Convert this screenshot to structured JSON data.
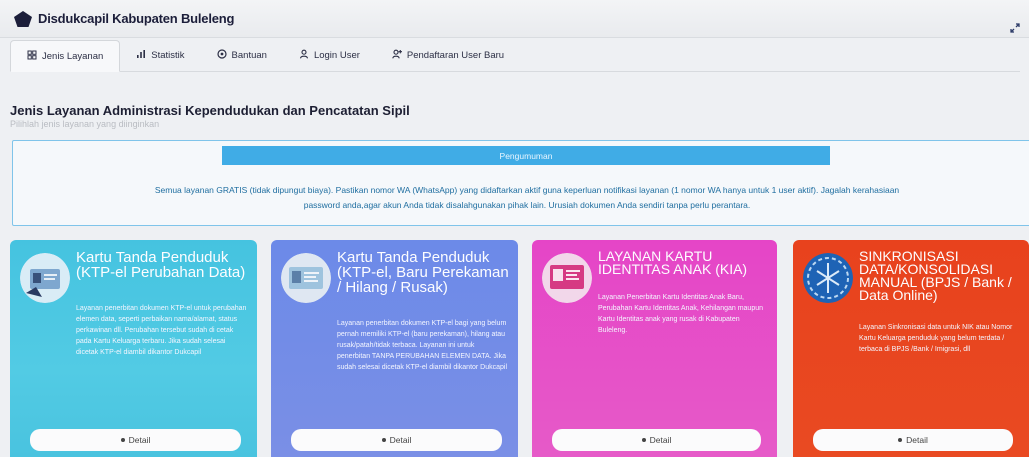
{
  "app": {
    "title": "Disdukcapil Kabupaten Buleleng",
    "logo_icon": "pentagon-logo-icon",
    "expand_icon": "expand-arrows-icon"
  },
  "tabs": [
    {
      "label": "Jenis Layanan",
      "icon": "grid-icon",
      "active": true
    },
    {
      "label": "Statistik",
      "icon": "bar-chart-icon",
      "active": false
    },
    {
      "label": "Bantuan",
      "icon": "help-circle-icon",
      "active": false
    },
    {
      "label": "Login User",
      "icon": "user-icon",
      "active": false
    },
    {
      "label": "Pendaftaran User Baru",
      "icon": "user-plus-icon",
      "active": false
    }
  ],
  "page": {
    "title": "Jenis Layanan Administrasi Kependudukan dan Pencatatan Sipil",
    "subtitle": "Pilihlah jenis layanan yang diinginkan"
  },
  "announcement": {
    "header": "Pengumuman",
    "line1": "Semua layanan GRATIS (tidak dipungut biaya). Pastikan nomor WA (WhatsApp) yang didaftarkan aktif guna keperluan notifikasi layanan (1 nomor WA hanya untuk 1 user aktif). Jagalah kerahasiaan",
    "line2": "password anda,agar akun Anda tidak disalahgunakan pihak lain. Urusiah dokumen Anda sendiri tanpa perlu perantara."
  },
  "cards": [
    {
      "title": "Kartu Tanda Penduduk (KTP-el Perubahan Data)",
      "description": "Layanan penerbitan dokumen KTP-el untuk perubahan elemen data, seperti perbaikan nama/alamat, status perkawinan dll. Perubahan tersebut sudah di cetak pada Kartu Keluarga terbaru. Jika sudah selesai dicetak KTP-el diambil dikantor Dukcapil",
      "button": "Detail",
      "color": "#45c3e0"
    },
    {
      "title": "Kartu Tanda Penduduk (KTP-el, Baru Perekaman / Hilang / Rusak)",
      "description": "Layanan penerbitan dokumen KTP-el bagi yang belum pernah memiliki KTP-el (baru perekaman), hilang atau rusak/patah/tidak terbaca. Layanan ini untuk penerbitan TANPA PERUBAHAN ELEMEN DATA. Jika sudah selesai dicetak KTP-el diambil dikantor Dukcapil",
      "button": "Detail",
      "color": "#6c8ae8"
    },
    {
      "title": "LAYANAN KARTU IDENTITAS ANAK (KIA)",
      "description": "Layanan Penerbitan Kartu Identitas Anak Baru, Perubahan Kartu Identitas Anak, Kehilangan maupun Kartu Identitas anak yang rusak di Kabupaten Buleleng.",
      "button": "Detail",
      "color": "#e545c7"
    },
    {
      "title": "SINKRONISASI DATA/KONSOLIDASI MANUAL (BPJS / Bank / Data Online)",
      "description": "Layanan Sinkronisasi data untuk NIK atau Nomor Kartu Keluarga penduduk yang belum terdata / terbaca di BPJS /Bank / Imigrasi, dll",
      "button": "Detail",
      "color": "#e8421d"
    }
  ]
}
